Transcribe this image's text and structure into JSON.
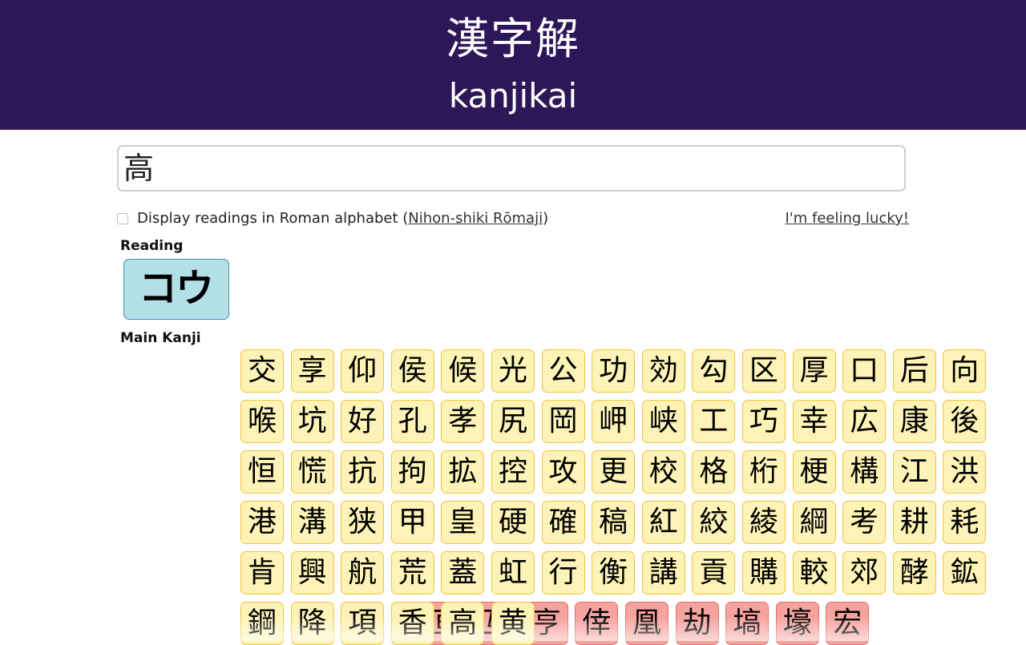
{
  "header": {
    "kanji_title": "漢字解",
    "latin_title": "kanjikai"
  },
  "search": {
    "value": "高"
  },
  "options": {
    "romaji_label": "Display readings in Roman alphabet (",
    "romaji_link": "Nihon-shiki Rōmaji",
    "romaji_close": ")",
    "romaji_checked": false,
    "lucky_link": "I'm feeling lucky!"
  },
  "reading": {
    "title": "Reading",
    "value": "コウ"
  },
  "main_kanji": {
    "title": "Main Kanji",
    "items": [
      "交",
      "享",
      "仰",
      "侯",
      "候",
      "光",
      "公",
      "功",
      "効",
      "勾",
      "区",
      "厚",
      "口",
      "后",
      "向",
      "喉",
      "坑",
      "好",
      "孔",
      "孝",
      "尻",
      "岡",
      "岬",
      "峡",
      "工",
      "巧",
      "幸",
      "広",
      "康",
      "後",
      "恒",
      "慌",
      "抗",
      "拘",
      "拡",
      "控",
      "攻",
      "更",
      "校",
      "格",
      "桁",
      "梗",
      "構",
      "江",
      "洪",
      "港",
      "溝",
      "狭",
      "甲",
      "皇",
      "硬",
      "確",
      "稿",
      "紅",
      "絞",
      "綾",
      "綱",
      "考",
      "耕",
      "耗",
      "肯",
      "興",
      "航",
      "荒",
      "蓋",
      "虹",
      "行",
      "衡",
      "講",
      "貢",
      "購",
      "較",
      "郊",
      "酵",
      "鉱",
      "鋼",
      "降",
      "項",
      "香",
      "高",
      "黄"
    ],
    "extra_items": [
      "亘",
      "互",
      "亨",
      "倖",
      "凰",
      "劫",
      "塙",
      "壕",
      "宏"
    ]
  },
  "colors": {
    "header_bg": "#2e1758",
    "main_tile": "#fdf3b6",
    "extra_tile": "#f6a3a0",
    "reading_tile": "#b3e0e7"
  }
}
